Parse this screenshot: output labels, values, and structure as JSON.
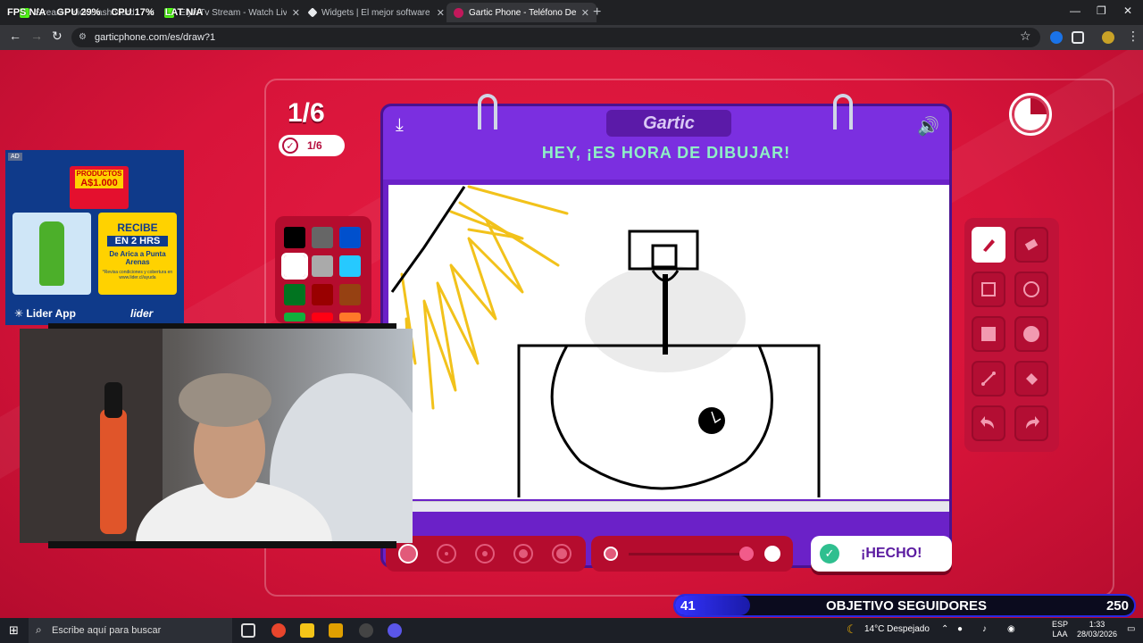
{
  "overlay_stats": {
    "fps_label": "FPS",
    "fps_value": "N/A",
    "gpu_label": "GPU",
    "gpu_value": "29%",
    "cpu_label": "CPU",
    "cpu_value": "17%",
    "lat_label": "LAT",
    "lat_value": "N/A"
  },
  "tabs": [
    {
      "title": "Stream - Kick Dashboard",
      "active": false,
      "color": "#53fc18"
    },
    {
      "title": "ElyteTv Stream - Watch Live on",
      "active": false,
      "color": "#53fc18"
    },
    {
      "title": "Widgets | El mejor software par",
      "active": false,
      "color": "#e8eaed"
    },
    {
      "title": "Gartic Phone - Teléfono Descon",
      "active": true,
      "color": "#c2185b"
    }
  ],
  "address": {
    "url": "garticphone.com/es/draw?1"
  },
  "game": {
    "round": "1/6",
    "done_count": "1/6",
    "logo": "Gartic",
    "banner": "HEY, ¡ES HORA DE DIBUJAR!",
    "done_button": "¡HECHO!",
    "timer_remaining": 0.75
  },
  "palette": [
    "#000000",
    "#666666",
    "#0050cd",
    "#ffffff",
    "#aaaaaa",
    "#26c9ff",
    "#017420",
    "#990000",
    "#964112",
    "#11b03c",
    "#ff0013",
    "#ff7829"
  ],
  "ad": {
    "tag": "AD",
    "promo_line1": "PRODUCTOS",
    "promo_line2": "A$1.000",
    "recibe": "RECIBE",
    "en2hrs": "EN 2 HRS",
    "route": "De Arica a Punta Arenas",
    "fineprint": "*Revisa condiciones y cobertura en www.lider.cl/ayuda",
    "app": "Lider App",
    "brand": "lider"
  },
  "goal": {
    "current": "41",
    "label": "OBJETIVO SEGUIDORES",
    "target": "250",
    "progress": 0.164
  },
  "taskbar": {
    "search_placeholder": "Escribe aquí para buscar",
    "weather": "14°C  Despejado",
    "lang1": "ESP",
    "lang2": "LAA",
    "time": "1:33",
    "date": "28/03/2026"
  }
}
